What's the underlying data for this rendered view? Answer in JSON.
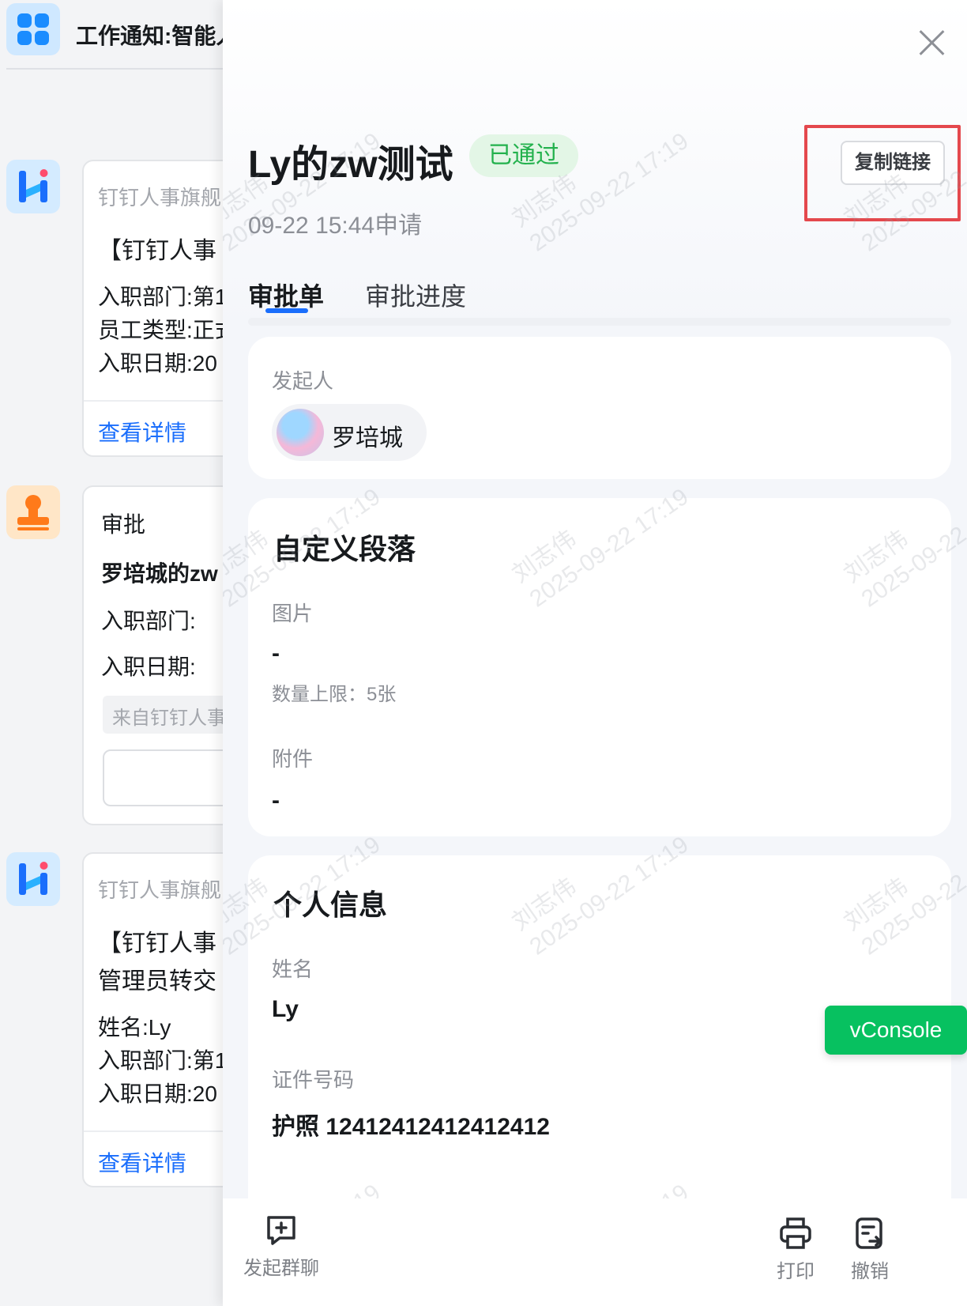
{
  "feed": {
    "header_title": "工作通知:智能人",
    "card1": {
      "source": "钉钉人事旗舰",
      "headline": "【钉钉人事",
      "lines": [
        "入职部门:第1",
        "员工类型:正式",
        "入职日期:20"
      ],
      "link": "查看详情"
    },
    "card2": {
      "source": "审批",
      "headline": "罗培城的zw",
      "lines": [
        "入职部门:",
        "入职日期:"
      ],
      "chip": "来自钉钉人事"
    },
    "card3": {
      "source": "钉钉人事旗舰",
      "headline": "【钉钉人事",
      "headline2": "管理员转交",
      "lines": [
        "姓名:Ly",
        "入职部门:第1",
        "入职日期:20"
      ],
      "link": "查看详情"
    }
  },
  "drawer": {
    "title": "Ly的zw测试",
    "status": "已通过",
    "status_color": "#23b14d",
    "submitted": "09-22 15:44申请",
    "copy_link": "复制链接",
    "tabs": [
      {
        "label": "审批单",
        "active": true
      },
      {
        "label": "审批进度",
        "active": false
      }
    ],
    "initiator": {
      "label": "发起人",
      "name": "罗培城"
    },
    "custom_section": {
      "title": "自定义段落",
      "image_label": "图片",
      "image_value": "-",
      "image_limit": "数量上限：5张",
      "attachment_label": "附件",
      "attachment_value": "-"
    },
    "personal_section": {
      "title": "个人信息",
      "name_label": "姓名",
      "name_value": "Ly",
      "id_label": "证件号码",
      "id_value": "护照 12412412412412412"
    },
    "vconsole": "vConsole",
    "bottom": {
      "group_chat": "发起群聊",
      "print": "打印",
      "revoke": "撤销"
    },
    "watermark_name": "刘志伟",
    "watermark_time": "2025-09-22 17:19"
  },
  "accent": "#1a6efc",
  "highlight_color": "#e4484d"
}
